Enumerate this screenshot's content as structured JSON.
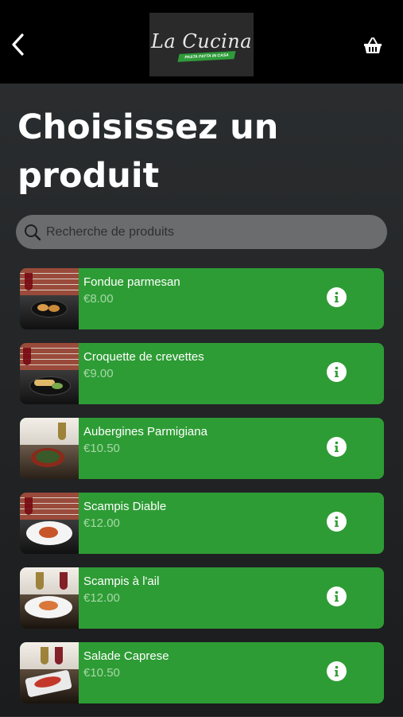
{
  "header": {
    "logo": {
      "text": "La Cucina",
      "ribbon": "PASTA FATTA IN CASA"
    }
  },
  "title": "Choisissez un produit",
  "search": {
    "placeholder": "Recherche de produits",
    "value": ""
  },
  "products": [
    {
      "name": "Fondue parmesan",
      "price": "€8.00",
      "photo": "fondue-parmesan-photo"
    },
    {
      "name": "Croquette de crevettes",
      "price": "€9.00",
      "photo": "croquette-crevettes-photo"
    },
    {
      "name": "Aubergines Parmigiana",
      "price": "€10.50",
      "photo": "aubergines-parmigiana-photo"
    },
    {
      "name": "Scampis Diable",
      "price": "€12.00",
      "photo": "scampis-diable-photo"
    },
    {
      "name": "Scampis à l'ail",
      "price": "€12.00",
      "photo": "scampis-ail-photo"
    },
    {
      "name": "Salade Caprese",
      "price": "€10.50",
      "photo": "salade-caprese-photo"
    }
  ],
  "icons": {
    "back": "chevron-left-icon",
    "cart": "basket-icon",
    "search": "search-icon",
    "info": "info-icon"
  },
  "colors": {
    "card_green": "#2e9c35",
    "price_text": "#a6d8a8",
    "header_bg": "#000000",
    "search_bg": "#6b6c6e"
  }
}
